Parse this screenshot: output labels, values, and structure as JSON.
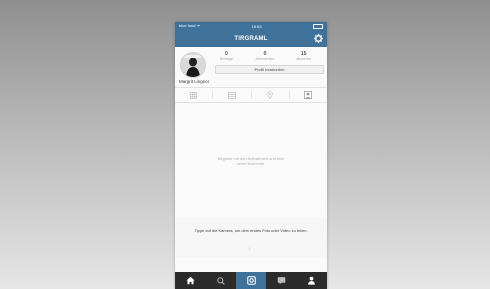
{
  "statusbar": {
    "carrier": "blue fund ᯤ",
    "time": "16:53",
    "battery_icon": "battery-icon"
  },
  "navbar": {
    "title": "TIRGRAML",
    "settings_icon": "gear-icon"
  },
  "profile": {
    "stats": [
      {
        "num": "0",
        "label": "Beiträge"
      },
      {
        "num": "0",
        "label": "Abonnenten"
      },
      {
        "num": "15",
        "label": "abonniert"
      }
    ],
    "edit_button": "Profil bearbeiten",
    "username": "Margrit Lingner"
  },
  "tabs": [
    "grid-icon",
    "list-icon",
    "location-icon",
    "tagged-icon"
  ],
  "empty": {
    "message": "Beginne mit den Aufnahmen und teile deine Momente."
  },
  "hint": {
    "message": "Tippe auf die Kamera, um dein erstes Foto oder Video zu teilen."
  },
  "tabbar": {
    "items": [
      "home-icon",
      "search-icon",
      "camera-icon",
      "activity-icon",
      "profile-icon"
    ],
    "active_index": 2
  },
  "colors": {
    "accent": "#3f729b",
    "tabbar": "#2b2b2b",
    "background": "#fafafa"
  }
}
